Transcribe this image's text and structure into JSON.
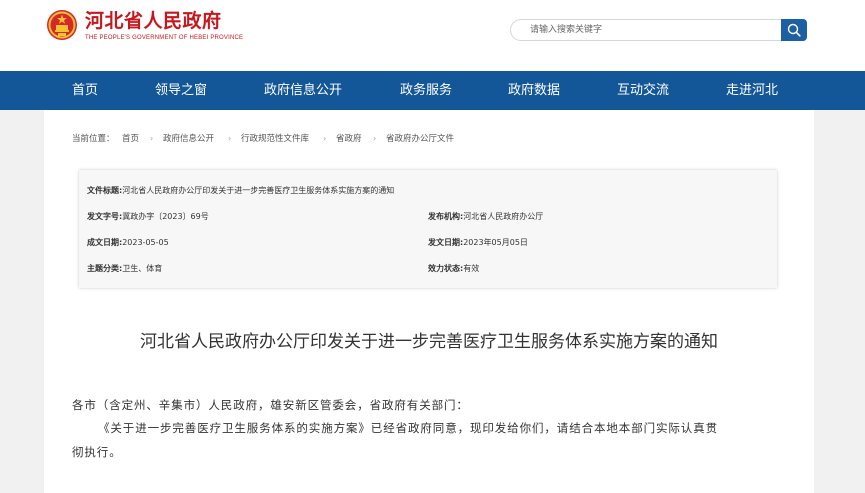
{
  "header": {
    "site_title": "河北省人民政府",
    "site_subtitle": "THE PEOPLE'S GOVERNMENT OF HEBEI PROVINCE",
    "search_placeholder": "请输入搜索关键字"
  },
  "nav": {
    "items": [
      "首页",
      "领导之窗",
      "政府信息公开",
      "政务服务",
      "政府数据",
      "互动交流",
      "走进河北"
    ]
  },
  "breadcrumb": {
    "label": "当前位置：",
    "items": [
      "首页",
      "政府信息公开",
      "行政规范性文件库",
      "省政府",
      "省政府办公厅文件"
    ],
    "separator": "›"
  },
  "info": {
    "title_label": "文件标题:",
    "title_value": "河北省人民政府办公厅印发关于进一步完善医疗卫生服务体系实施方案的通知",
    "doc_no_label": "发文字号:",
    "doc_no_value": "冀政办字〔2023〕69号",
    "issuer_label": "发布机构:",
    "issuer_value": "河北省人民政府办公厅",
    "created_label": "成文日期:",
    "created_value": "2023-05-05",
    "published_label": "发文日期:",
    "published_value": "2023年05月05日",
    "category_label": "主题分类:",
    "category_value": "卫生、体育",
    "status_label": "效力状态:",
    "status_value": "有效"
  },
  "document": {
    "title": "河北省人民政府办公厅印发关于进一步完善医疗卫生服务体系实施方案的通知",
    "salutation": "各市（含定州、辛集市）人民政府，雄安新区管委会，省政府有关部门：",
    "para1_line1": "《关于进一步完善医疗卫生服务体系的实施方案》已经省政府同意，现印发给你们，请结合本地本部门实际认真贯",
    "para1_line2": "彻执行。"
  },
  "colors": {
    "brand_red": "#c8161d",
    "nav_blue": "#145798",
    "search_button": "#1c5fa3"
  },
  "icons": {
    "emblem": "national-emblem-icon",
    "search": "magnifier-icon"
  }
}
